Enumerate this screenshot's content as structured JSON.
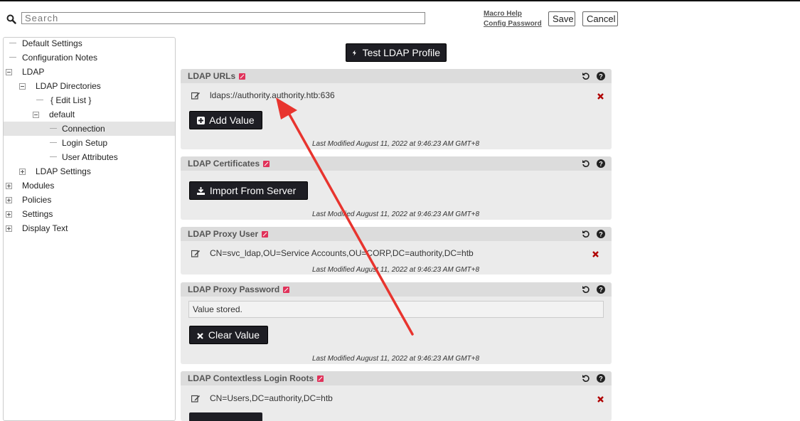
{
  "search": {
    "placeholder": "Search"
  },
  "header": {
    "macro_help": "Macro Help",
    "config_password": "Config Password",
    "save_label": "Save",
    "cancel_label": "Cancel"
  },
  "nav": {
    "default_settings": "Default Settings",
    "configuration_notes": "Configuration Notes",
    "ldap": "LDAP",
    "ldap_directories": "LDAP Directories",
    "edit_list": "{ Edit List }",
    "default": "default",
    "connection": "Connection",
    "login_setup": "Login Setup",
    "user_attributes": "User Attributes",
    "ldap_settings": "LDAP Settings",
    "modules": "Modules",
    "policies": "Policies",
    "settings": "Settings",
    "display_text": "Display Text"
  },
  "main": {
    "test_button": "Test LDAP Profile",
    "modified": "Last Modified August 11, 2022 at 9:46:23 AM GMT+8",
    "panels": {
      "urls": {
        "title": "LDAP URLs",
        "value": "ldaps://authority.authority.htb:636",
        "button": "Add Value"
      },
      "certs": {
        "title": "LDAP Certificates",
        "button": "Import From Server"
      },
      "proxy_user": {
        "title": "LDAP Proxy User",
        "value": "CN=svc_ldap,OU=Service Accounts,OU=CORP,DC=authority,DC=htb"
      },
      "proxy_password": {
        "title": "LDAP Proxy Password",
        "stored": "Value stored.",
        "button": "Clear Value"
      },
      "login_roots": {
        "title": "LDAP Contextless Login Roots",
        "value": "CN=Users,DC=authority,DC=htb"
      }
    }
  },
  "colors": {
    "accent_pencil": "#e0325a",
    "button_dark": "#1e1e24",
    "remove_red": "#b00000",
    "annotation_arrow": "#e8342e"
  },
  "icons": [
    "search-icon",
    "undo-icon",
    "help-icon",
    "edit-icon",
    "remove-icon",
    "plus-icon",
    "download-icon",
    "x-icon",
    "bolt-icon"
  ]
}
